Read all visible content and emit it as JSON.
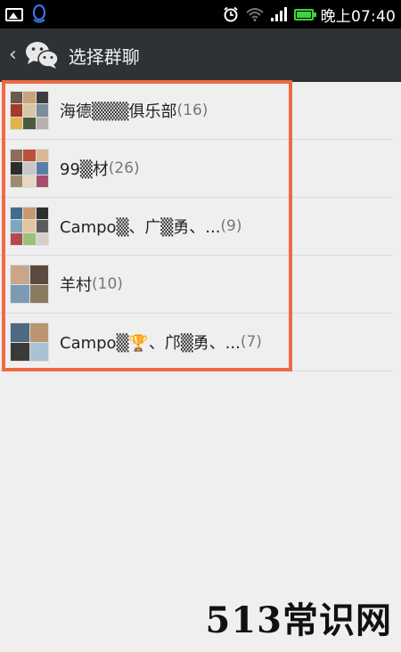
{
  "status_bar": {
    "time": "晚上07:40",
    "left_icons": [
      "image-icon",
      "qq-icon"
    ],
    "right_icons": [
      "alarm-icon",
      "wifi-icon",
      "signal-icon",
      "battery-icon"
    ]
  },
  "header": {
    "title": "选择群聊",
    "back_icon": "chevron-left-icon",
    "app_icon": "wechat-icon",
    "background": "#2f3235"
  },
  "groups": [
    {
      "name": "海德▒▒▒俱乐部",
      "count": "(16)",
      "avatar_layout": "grid-9"
    },
    {
      "name": "99▒材",
      "count": "(26)",
      "avatar_layout": "grid-9"
    },
    {
      "name": "Campo▒、广▒勇、...",
      "count": "(9)",
      "avatar_layout": "grid-9"
    },
    {
      "name": "羊村",
      "count": "(10)",
      "avatar_layout": "grid-4"
    },
    {
      "name": "Campo▒🏆、邝▒勇、...",
      "count": "(7)",
      "avatar_layout": "grid-4"
    }
  ],
  "highlight_color": "#ef6a43",
  "watermark": "513常识网"
}
